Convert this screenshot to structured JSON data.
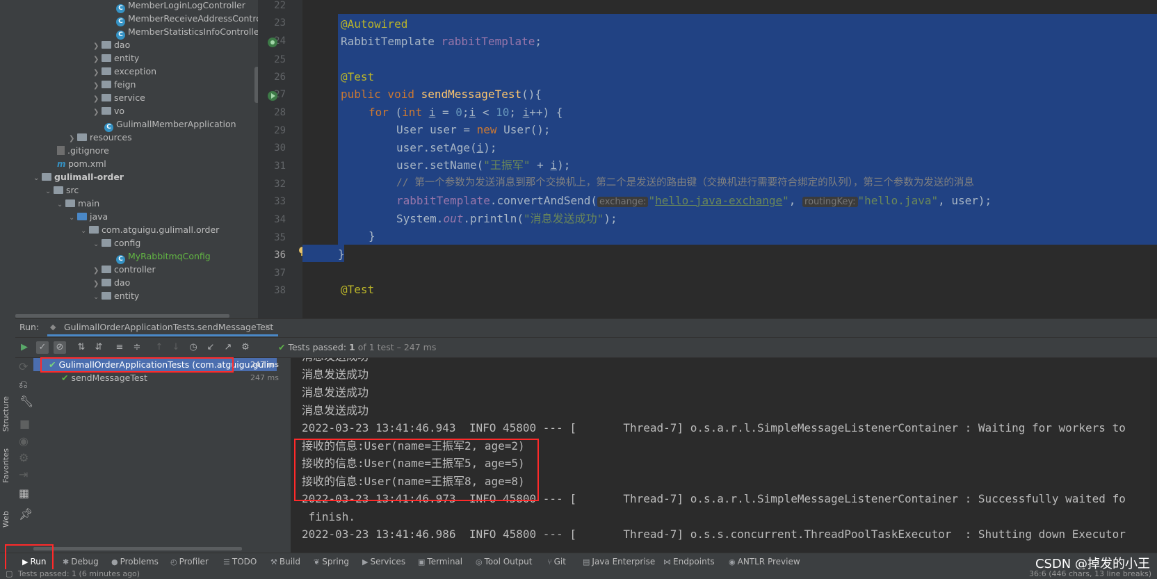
{
  "project_tree": {
    "rows": [
      {
        "label": "MemberLoginLogController",
        "kind": "class"
      },
      {
        "label": "MemberReceiveAddressContro",
        "kind": "class"
      },
      {
        "label": "MemberStatisticsInfoController",
        "kind": "class"
      },
      {
        "label": "dao",
        "kind": "folder"
      },
      {
        "label": "entity",
        "kind": "folder"
      },
      {
        "label": "exception",
        "kind": "folder"
      },
      {
        "label": "feign",
        "kind": "folder"
      },
      {
        "label": "service",
        "kind": "folder"
      },
      {
        "label": "vo",
        "kind": "folder"
      },
      {
        "label": "GulimallMemberApplication",
        "kind": "app"
      },
      {
        "label": "resources",
        "kind": "folder"
      },
      {
        "label": ".gitignore",
        "kind": "file"
      },
      {
        "label": "pom.xml",
        "kind": "maven"
      },
      {
        "label": "gulimall-order",
        "kind": "module"
      },
      {
        "label": "src",
        "kind": "folder"
      },
      {
        "label": "main",
        "kind": "folder"
      },
      {
        "label": "java",
        "kind": "source"
      },
      {
        "label": "com.atguigu.gulimall.order",
        "kind": "package"
      },
      {
        "label": "config",
        "kind": "folder"
      },
      {
        "label": "MyRabbitmqConfig",
        "kind": "class-green"
      },
      {
        "label": "controller",
        "kind": "folder"
      },
      {
        "label": "dao",
        "kind": "folder"
      },
      {
        "label": "entity",
        "kind": "folder"
      }
    ]
  },
  "editor": {
    "line_numbers": [
      "22",
      "23",
      "24",
      "25",
      "26",
      "27",
      "28",
      "29",
      "30",
      "31",
      "32",
      "33",
      "34",
      "35",
      "36",
      "37",
      "38"
    ],
    "current_line": "36",
    "code": {
      "l23": "@Autowired",
      "l24_type": "RabbitTemplate",
      "l24_field": "rabbitTemplate",
      "l26": "@Test",
      "l27_kw": "public void",
      "l27_fn": "sendMessageTest",
      "l27_rest": "(){",
      "l28_for": "for",
      "l28_int": "int",
      "l28_var": "i",
      "l28_zero": "0",
      "l28_ten": "10",
      "l29_pre": "User user = ",
      "l29_new": "new",
      "l29_post": " User();",
      "l30_pre": "user.setAge(",
      "l30_var": "i",
      "l30_post": ");",
      "l31_pre": "user.setName(",
      "l31_str": "\"王振军\"",
      "l31_mid": " + ",
      "l31_var": "i",
      "l31_post": ");",
      "l32": "// 第一个参数为发送消息到那个交换机上，第二个是发送的路由键（交换机进行需要符合绑定的队列），第三个参数为发送的消息",
      "l33_field": "rabbitTemplate",
      "l33_call": ".convertAndSend(",
      "l33_hint1": "exchange:",
      "l33_str1": "hello-java-exchange",
      "l33_hint2": "routingKey:",
      "l33_str2": "\"hello.java\"",
      "l33_post": ", user);",
      "l34_pre": "System.",
      "l34_out": "out",
      "l34_mid": ".println(",
      "l34_str": "\"消息发送成功\"",
      "l34_post": ");",
      "l35": "}",
      "l36": "}",
      "l38": "@Test"
    }
  },
  "run_panel": {
    "label": "Run:",
    "tab_title": "GulimallOrderApplicationTests.sendMessageTest",
    "status_prefix": "Tests passed:",
    "status_count": "1",
    "status_rest": "of 1 test – 247 ms",
    "test_tree": [
      {
        "label": "GulimallOrderApplicationTests (com.atguigu.gulin",
        "time": "247 ms"
      },
      {
        "label": "sendMessageTest",
        "time": "247 ms"
      }
    ],
    "console_lines": [
      "消息发送成功",
      "消息发送成功",
      "消息发送成功",
      "消息发送成功",
      "2022-03-23 13:41:46.943  INFO 45800 --- [       Thread-7] o.s.a.r.l.SimpleMessageListenerContainer : Waiting for workers to",
      "接收的信息:User(name=王振军2, age=2)",
      "接收的信息:User(name=王振军5, age=5)",
      "接收的信息:User(name=王振军8, age=8)",
      "2022-03-23 13:41:46.973  INFO 45800 --- [       Thread-7] o.s.a.r.l.SimpleMessageListenerContainer : Successfully waited fo",
      " finish.",
      "2022-03-23 13:41:46.986  INFO 45800 --- [       Thread-7] o.s.s.concurrent.ThreadPoolTaskExecutor  : Shutting down Executor"
    ]
  },
  "side_labels": {
    "structure": "Structure",
    "favorites": "Favorites",
    "web": "Web"
  },
  "bottom_tabs": [
    "Run",
    "Debug",
    "Problems",
    "Profiler",
    "TODO",
    "Build",
    "Spring",
    "Services",
    "Terminal",
    "Tool Output",
    "Git",
    "Java Enterprise",
    "Endpoints",
    "ANTLR Preview"
  ],
  "status_bar": {
    "left": "Tests passed: 1 (6 minutes ago)",
    "right": "36:6 (446 chars, 13 line breaks)"
  },
  "watermark": "CSDN @掉发的小王",
  "colors": {
    "selection": "#214283",
    "highlight_box": "#ff2a2a",
    "pass_green": "#5fb24a"
  }
}
